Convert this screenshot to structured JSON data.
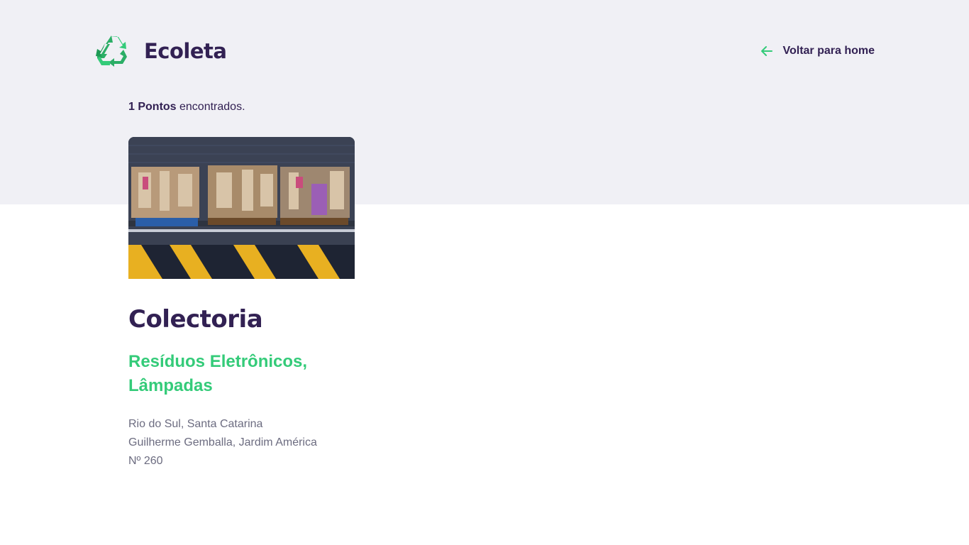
{
  "brand": {
    "name": "Ecoleta",
    "logo_icon": "recycle-icon",
    "logo_color": "#34CB79"
  },
  "nav": {
    "back_label": "Voltar para home",
    "back_icon": "arrow-left-icon"
  },
  "results": {
    "count": "1 Pontos",
    "suffix": " encontrados."
  },
  "point": {
    "name": "Colectoria",
    "items": "Resíduos Eletrônicos, Lâmpadas",
    "address_line1": "Rio do Sul, Santa Catarina",
    "address_line2": "Guilherme Gemballa, Jardim América",
    "address_line3": "Nº 260"
  },
  "colors": {
    "primary": "#322153",
    "accent": "#34CB79",
    "text": "#6C6C80",
    "band": "#F0F0F5"
  }
}
